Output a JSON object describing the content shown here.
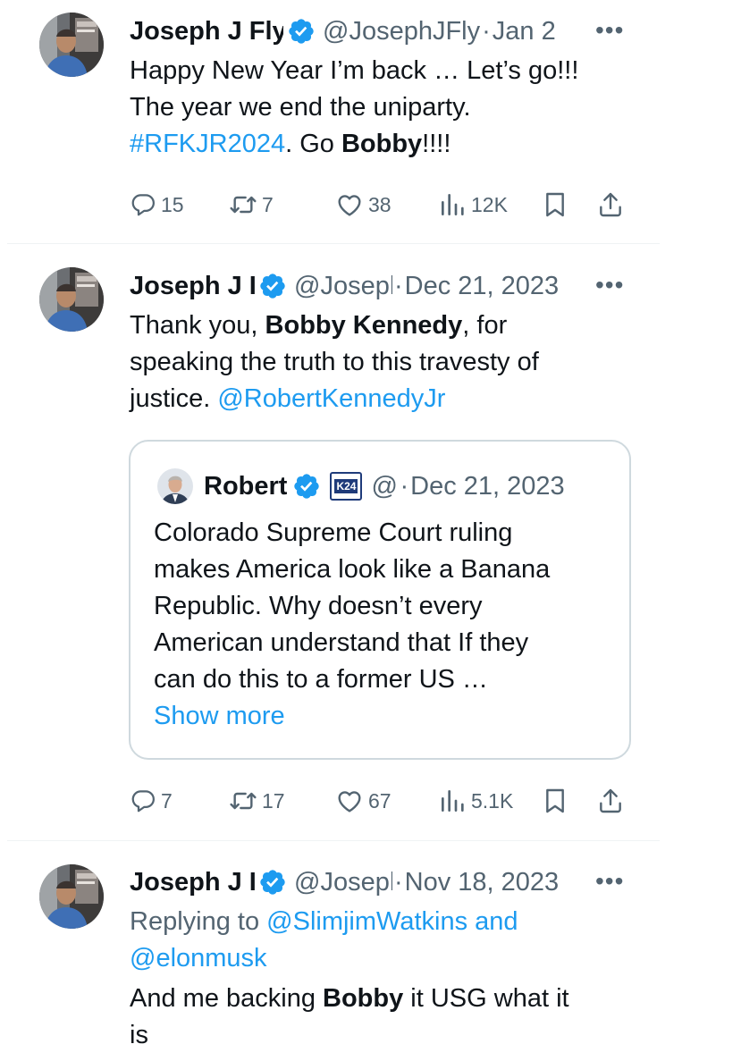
{
  "colors": {
    "link": "#1d9bf0",
    "muted": "#536471",
    "verified": "#1d9bf0",
    "border": "#cfd9de"
  },
  "tweets": [
    {
      "name": "Joseph J Fly",
      "handle": "@JosephJFly",
      "dot": "·",
      "date": "Jan 2",
      "more": "•••",
      "text": {
        "l1": "Happy New Year I’m back … Let’s go!!!",
        "l2": "The year we end the uniparty.",
        "l3_hashtag": "#RFKJR2024",
        "l3_mid": ". Go ",
        "l3_bold": "Bobby",
        "l3_end": "!!!!"
      },
      "actions": {
        "replies": "15",
        "retweets": "7",
        "likes": "38",
        "views": "12K"
      }
    },
    {
      "name": "Joseph J I",
      "handle": "@JosephJFly",
      "dot": "·",
      "date": "Dec 21, 2023",
      "more": "•••",
      "text": {
        "l1_a": "Thank you, ",
        "l1_bold": "Bobby Kennedy",
        "l1_b": ", for",
        "l2": "speaking the truth to this travesty of",
        "l3_a": "justice. ",
        "l3_link": "@RobertKennedyJr"
      },
      "quote": {
        "name": "Robert",
        "badge": "K24",
        "handle": "@RobertKennedyJr",
        "dot": "·",
        "date": "Dec 21, 2023",
        "lines": [
          "Colorado Supreme Court ruling",
          "makes America look like a Banana",
          "Republic. Why doesn’t every",
          "American understand that If they",
          "can do this to a former US …"
        ],
        "show_more": "Show more"
      },
      "actions": {
        "replies": "7",
        "retweets": "17",
        "likes": "67",
        "views": "5.1K"
      }
    },
    {
      "name": "Joseph J I",
      "handle": "@JosephJFly",
      "dot": "·",
      "date": "Nov 18, 2023",
      "more": "•••",
      "reply_prefix": "Replying to ",
      "reply_to_1": "@SlimjimWatkins",
      "reply_and": " and",
      "reply_to_2": "@elonmusk",
      "text": {
        "l1_a": "And me backing ",
        "l1_bold": "Bobby",
        "l1_b": " it USG what it",
        "l2": "is"
      }
    }
  ]
}
